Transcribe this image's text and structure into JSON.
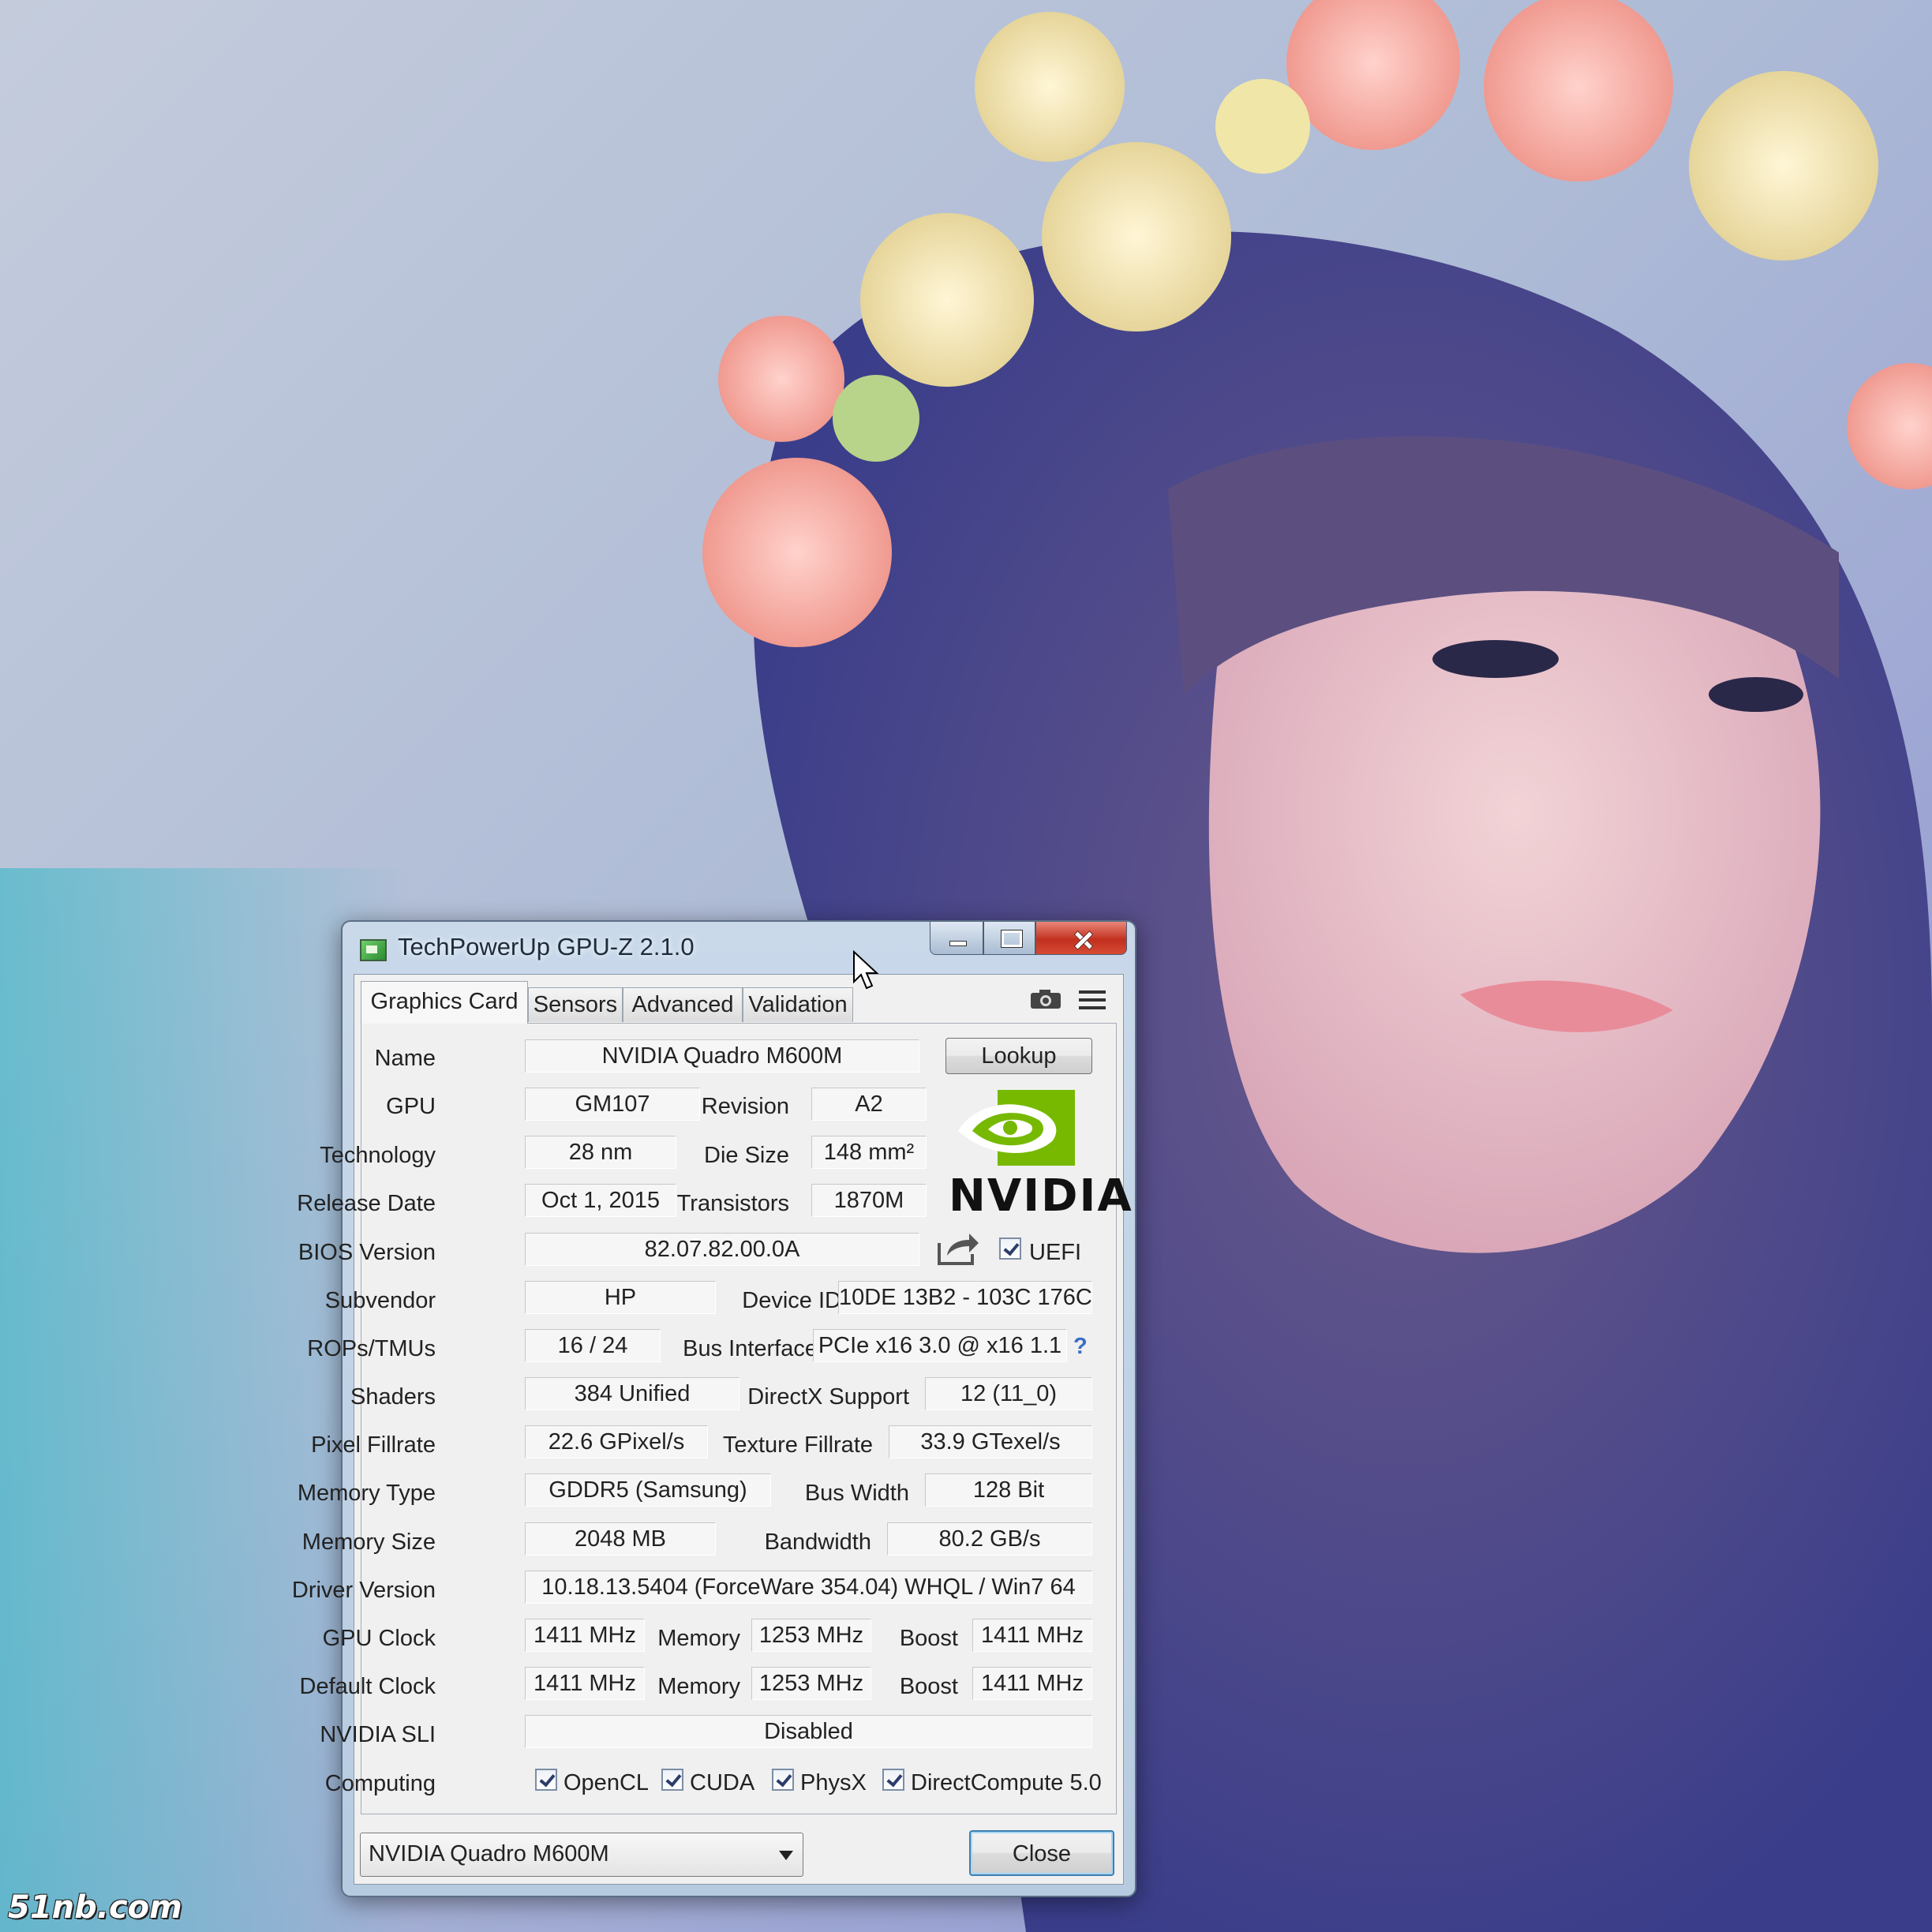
{
  "window": {
    "title": "TechPowerUp GPU-Z 2.1.0"
  },
  "tabs": [
    {
      "label": "Graphics Card"
    },
    {
      "label": "Sensors"
    },
    {
      "label": "Advanced"
    },
    {
      "label": "Validation"
    }
  ],
  "toolbar_icons": [
    "camera-icon",
    "menu-icon"
  ],
  "fields": {
    "name_label": "Name",
    "name": "NVIDIA Quadro M600M",
    "lookup": "Lookup",
    "gpu_label": "GPU",
    "gpu": "GM107",
    "revision_label": "Revision",
    "revision": "A2",
    "technology_label": "Technology",
    "technology": "28 nm",
    "die_size_label": "Die Size",
    "die_size": "148 mm²",
    "release_date_label": "Release Date",
    "release_date": "Oct 1, 2015",
    "transistors_label": "Transistors",
    "transistors": "1870M",
    "bios_label": "BIOS Version",
    "bios": "82.07.82.00.0A",
    "uefi_label": "UEFI",
    "subvendor_label": "Subvendor",
    "subvendor": "HP",
    "device_id_label": "Device ID",
    "device_id": "10DE 13B2 - 103C 176C",
    "rops_label": "ROPs/TMUs",
    "rops": "16 / 24",
    "bus_interface_label": "Bus Interface",
    "bus_interface": "PCIe x16 3.0 @ x16 1.1",
    "bus_help": "?",
    "shaders_label": "Shaders",
    "shaders": "384 Unified",
    "directx_label": "DirectX Support",
    "directx": "12 (11_0)",
    "pixel_fillrate_label": "Pixel Fillrate",
    "pixel_fillrate": "22.6 GPixel/s",
    "texture_fillrate_label": "Texture Fillrate",
    "texture_fillrate": "33.9 GTexel/s",
    "memory_type_label": "Memory Type",
    "memory_type": "GDDR5 (Samsung)",
    "bus_width_label": "Bus Width",
    "bus_width": "128 Bit",
    "memory_size_label": "Memory Size",
    "memory_size": "2048 MB",
    "bandwidth_label": "Bandwidth",
    "bandwidth": "80.2 GB/s",
    "driver_label": "Driver Version",
    "driver": "10.18.13.5404 (ForceWare 354.04) WHQL / Win7 64",
    "gpu_clock_label": "GPU Clock",
    "gpu_clock": "1411 MHz",
    "memory_label": "Memory",
    "gpu_clock_memory": "1253 MHz",
    "boost_label": "Boost",
    "gpu_clock_boost": "1411 MHz",
    "default_clock_label": "Default Clock",
    "default_clock": "1411 MHz",
    "default_clock_memory": "1253 MHz",
    "default_clock_boost": "1411 MHz",
    "sli_label": "NVIDIA SLI",
    "sli": "Disabled",
    "computing_label": "Computing",
    "opencl": "OpenCL",
    "cuda": "CUDA",
    "physx": "PhysX",
    "directcompute": "DirectCompute 5.0"
  },
  "logo": {
    "brand": "NVIDIA",
    "color": "#76b900"
  },
  "footer": {
    "selected_gpu": "NVIDIA Quadro M600M",
    "close": "Close"
  },
  "watermark": "51nb.com"
}
